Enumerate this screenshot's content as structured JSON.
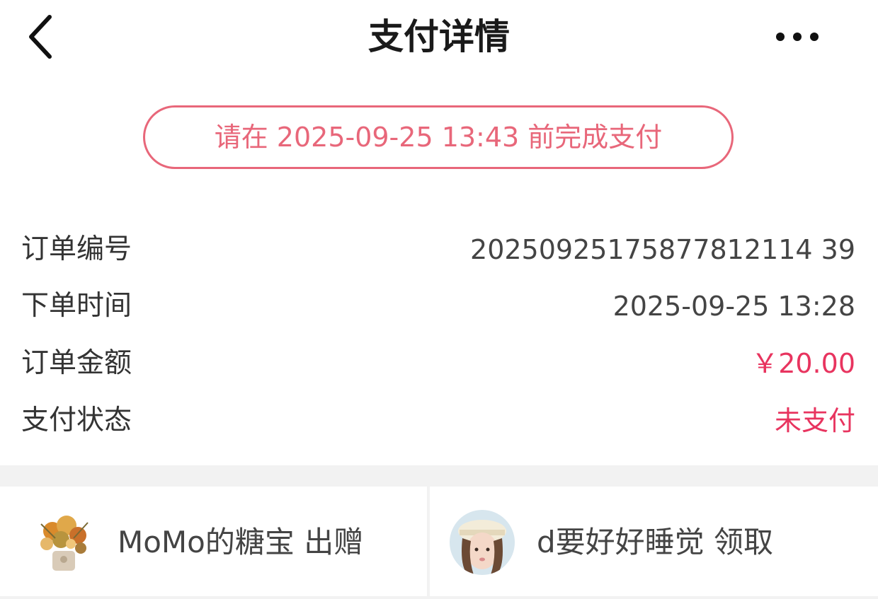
{
  "header": {
    "title": "支付详情",
    "back_icon": "chevron-left-icon",
    "more_icon": "more-horizontal-icon"
  },
  "deadline": {
    "text": "请在 2025-09-25 13:43 前完成支付",
    "color": "#e8677a"
  },
  "order": {
    "rows": [
      {
        "label": "订单编号",
        "value": "20250925175877812114 39"
      },
      {
        "label": "下单时间",
        "value": "2025-09-25 13:28"
      },
      {
        "label": "订单金额",
        "value": "￥20.00"
      },
      {
        "label": "支付状态",
        "value": "未支付"
      }
    ]
  },
  "transfer": {
    "giver": {
      "text": "MoMo的糖宝 出赠",
      "avatar_icon": "flower-bouquet-avatar"
    },
    "receiver": {
      "text": "d要好好睡觉 领取",
      "avatar_icon": "user-photo-avatar"
    }
  },
  "colors": {
    "accent": "#e8345f",
    "deadline": "#e8677a",
    "band": "#f2f2f2"
  }
}
